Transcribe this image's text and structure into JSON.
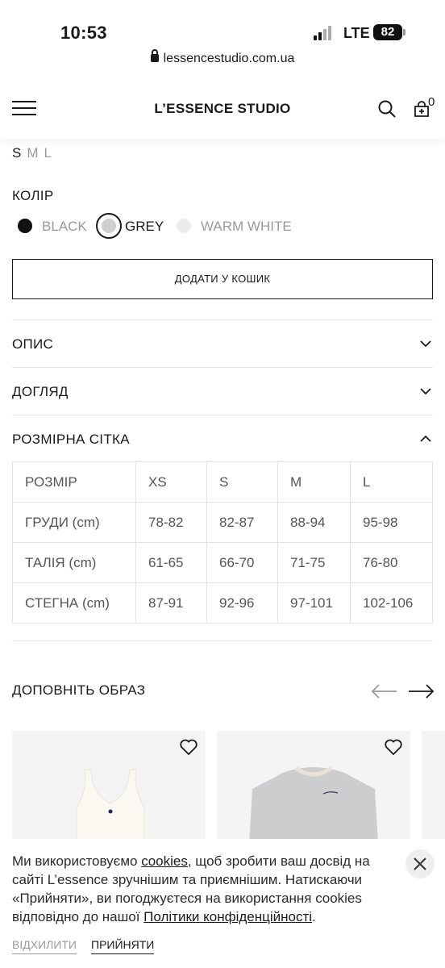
{
  "status_bar": {
    "time": "10:53",
    "network": "LTE",
    "battery": "82"
  },
  "browser": {
    "url": "lessencestudio.com.ua"
  },
  "header": {
    "brand": "L’ESSENCE STUDIO",
    "cart_count": "0"
  },
  "product": {
    "sizes": [
      "S",
      "M",
      "L"
    ],
    "color_title": "КОЛІР",
    "colors": [
      {
        "label": "BLACK",
        "swatch": "#111111"
      },
      {
        "label": "GREY",
        "swatch": "#cfcfcf"
      },
      {
        "label": "WARM WHITE",
        "swatch": "#ebebeb"
      }
    ],
    "add_to_cart": "ДОДАТИ У КОШИК"
  },
  "accordion": {
    "description": "ОПИС",
    "care": "ДОГЛЯД",
    "size_chart": "РОЗМІРНА СІТКА"
  },
  "size_table": {
    "header": [
      "РОЗМІР",
      "XS",
      "S",
      "M",
      "L"
    ],
    "rows": [
      [
        "ГРУДИ (cm)",
        "78-82",
        "82-87",
        "88-94",
        "95-98"
      ],
      [
        "ТАЛІЯ (cm)",
        "61-65",
        "66-70",
        "71-75",
        "76-80"
      ],
      [
        "СТЕГНА (cm)",
        "87-91",
        "92-96",
        "97-101",
        "102-106"
      ]
    ]
  },
  "recommendations": {
    "title": "ДОПОВНІТЬ ОБРАЗ"
  },
  "cookie": {
    "text_1": "Ми використовуємо ",
    "link_cookies": "cookies",
    "text_2": ", щоб зробити ваш досвід на сайті L’essence зручнішим та приємнішим. Натискаючи «Прийняти», ви погоджуєтеся на використання cookies відповідно до нашої ",
    "link_policy": "Політики конфіденційності",
    "text_3": ".",
    "reject": "ВІДХИЛИТИ",
    "accept": "ПРИЙНЯТИ"
  }
}
